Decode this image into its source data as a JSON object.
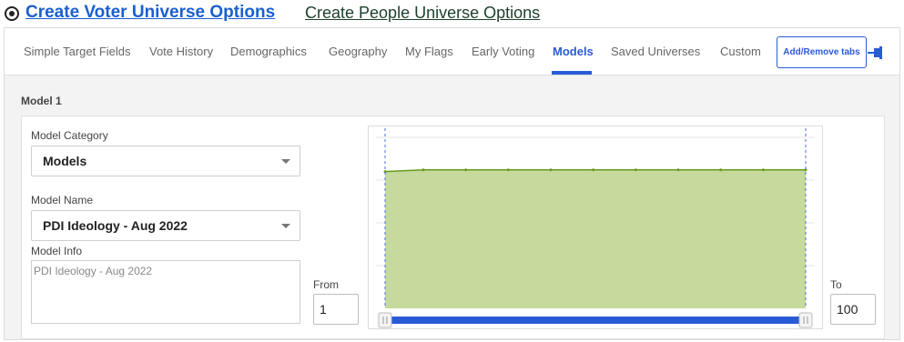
{
  "options": {
    "voter_universe": "Create Voter Universe Options",
    "people_universe": "Create People Universe Options"
  },
  "tabs": [
    {
      "label": "Simple Target Fields",
      "active": false
    },
    {
      "label": "Vote History",
      "active": false
    },
    {
      "label": "Demographics",
      "active": false
    },
    {
      "label": "Geography",
      "active": false
    },
    {
      "label": "My Flags",
      "active": false
    },
    {
      "label": "Early Voting",
      "active": false
    },
    {
      "label": "Models",
      "active": true
    },
    {
      "label": "Saved Universes",
      "active": false
    },
    {
      "label": "Custom",
      "active": false
    }
  ],
  "add_remove_tabs": "Add/Remove tabs",
  "model": {
    "title": "Model 1",
    "category_label": "Model Category",
    "category_value": "Models",
    "name_label": "Model Name",
    "name_value": "PDI Ideology - Aug 2022",
    "info_label": "Model Info",
    "info_value": "PDI Ideology - Aug 2022",
    "from_label": "From",
    "from_value": "1",
    "to_label": "To",
    "to_value": "100"
  },
  "colors": {
    "accent": "#2a5bd7",
    "area_fill": "#c5da9c",
    "area_line": "#6a9a1c",
    "range_bar": "#2a5bd7"
  },
  "chart_data": {
    "type": "area",
    "x": [
      1,
      10,
      20,
      30,
      40,
      50,
      60,
      70,
      80,
      90,
      100
    ],
    "values": [
      0.8,
      0.81,
      0.81,
      0.81,
      0.81,
      0.81,
      0.81,
      0.81,
      0.81,
      0.81,
      0.81
    ],
    "ylim": [
      0,
      1
    ],
    "xlim": [
      1,
      100
    ],
    "selected_range": [
      1,
      100
    ],
    "grid": true
  }
}
